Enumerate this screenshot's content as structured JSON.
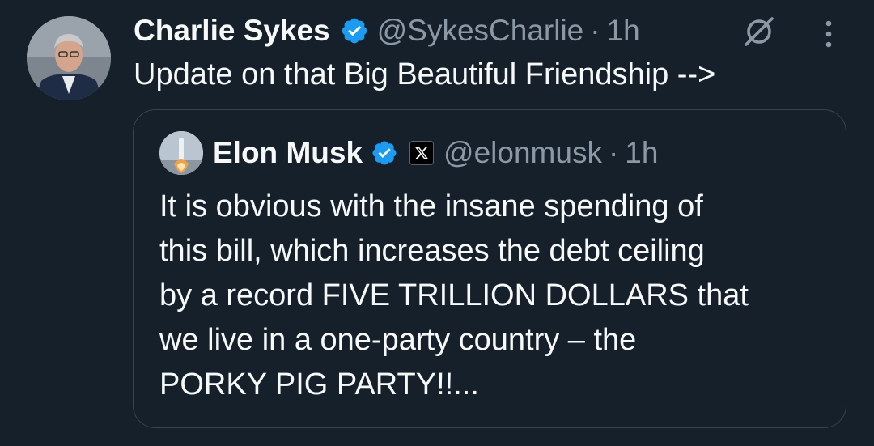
{
  "tweet": {
    "author": {
      "name": "Charlie Sykes",
      "handle": "@SykesCharlie",
      "time": "1h",
      "verified": true
    },
    "text": "Update on that Big Beautiful Friendship -->"
  },
  "quoted_tweet": {
    "author": {
      "name": "Elon Musk",
      "handle": "@elonmusk",
      "time": "1h",
      "verified": true,
      "affiliate_badge": "x-logo-icon"
    },
    "text": "It is obvious with the insane spending of\nthis bill, which increases the debt ceiling\nby a record FIVE TRILLION DOLLARS that\nwe live in a one-party country – the\nPORKY PIG PARTY!!..."
  },
  "icons": {
    "verified": "verified-badge-icon",
    "grok": "grok-icon",
    "more": "more-options-icon"
  },
  "colors": {
    "background": "#15202b",
    "verified_blue": "#1d9bf0",
    "secondary_text": "#8b98a5",
    "border": "#38444d"
  }
}
